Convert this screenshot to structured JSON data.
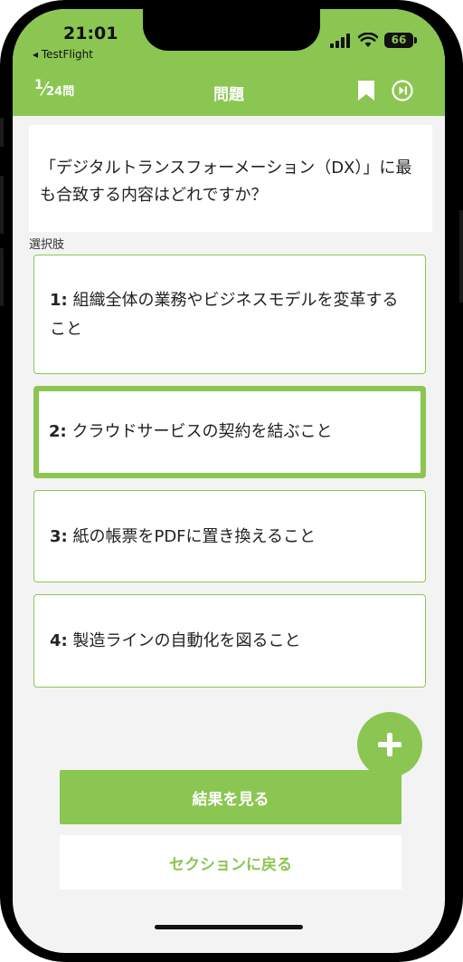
{
  "status_bar": {
    "time": "21:01",
    "back_app": "◂ TestFlight",
    "battery": "66"
  },
  "header": {
    "current": "1",
    "total": "24",
    "unit": "問",
    "title": "問題"
  },
  "question": {
    "text": "「デジタルトランスフォーメーション（DX）」に最も合致する内容はどれですか？"
  },
  "choices_label": "選択肢",
  "options": [
    {
      "num": "1:",
      "text": "組織全体の業務やビジネスモデルを変革すること",
      "selected": false
    },
    {
      "num": "2:",
      "text": "クラウドサービスの契約を結ぶこと",
      "selected": true
    },
    {
      "num": "3:",
      "text": "紙の帳票をPDFに置き換えること",
      "selected": false
    },
    {
      "num": "4:",
      "text": "製造ラインの自動化を図ること",
      "selected": false
    }
  ],
  "buttons": {
    "fab": "+",
    "result": "結果を見る",
    "back_to_section": "セクションに戻る"
  },
  "colors": {
    "accent": "#8bc652",
    "background": "#f3f3f3"
  }
}
